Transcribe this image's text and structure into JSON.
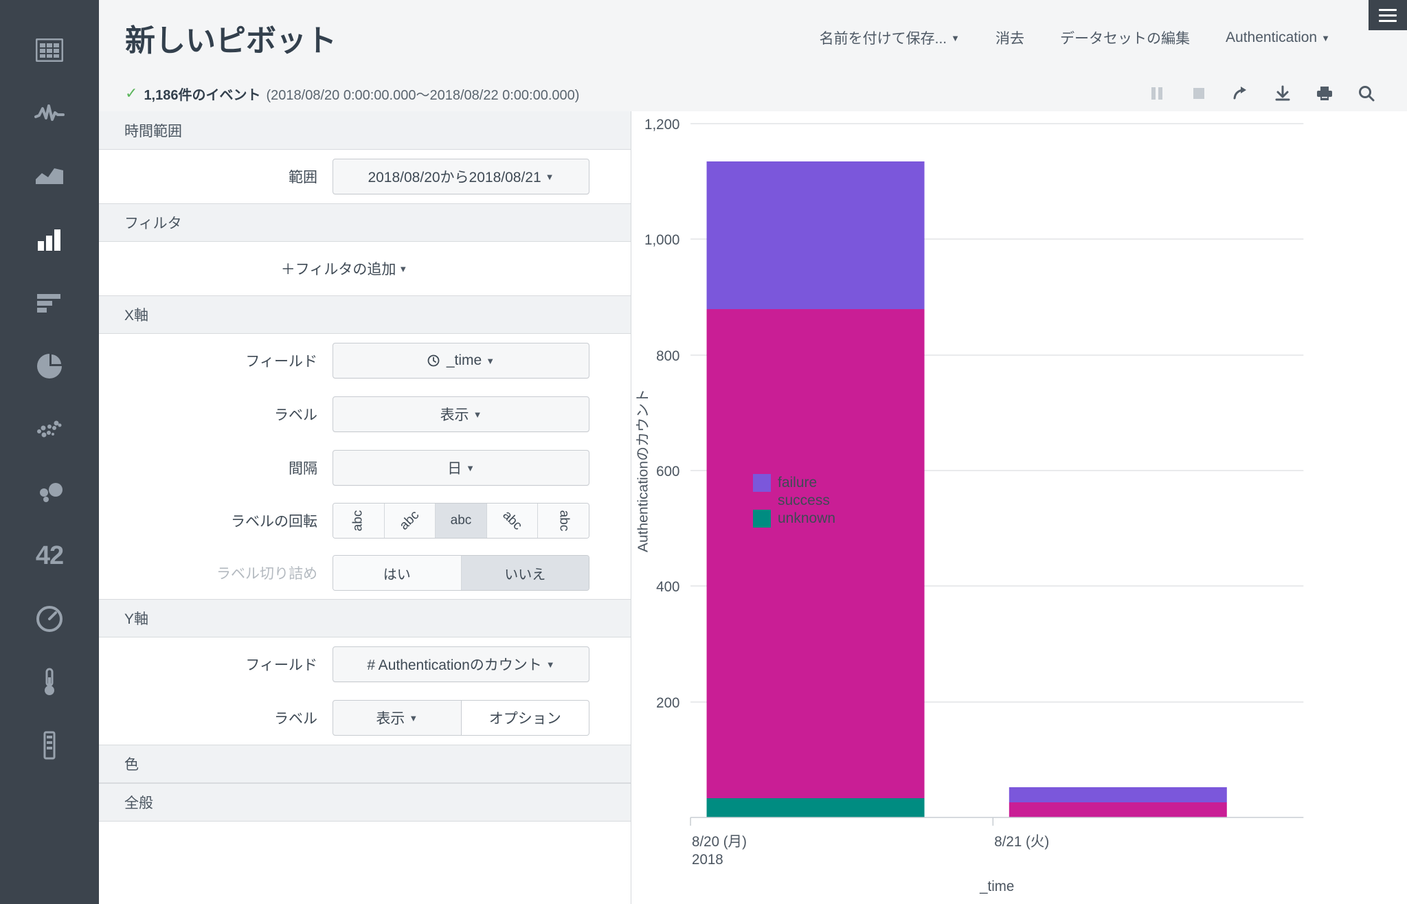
{
  "sidebar": {
    "items": [
      {
        "name": "table",
        "active": false
      },
      {
        "name": "line",
        "active": false
      },
      {
        "name": "area",
        "active": false
      },
      {
        "name": "column-bar",
        "active": true
      },
      {
        "name": "horizontal-bar",
        "active": false
      },
      {
        "name": "pie",
        "active": false
      },
      {
        "name": "scatter",
        "active": false
      },
      {
        "name": "bubble",
        "active": false
      },
      {
        "name": "single-value",
        "active": false,
        "text": "42"
      },
      {
        "name": "gauge-radial",
        "active": false
      },
      {
        "name": "gauge-thermometer",
        "active": false
      },
      {
        "name": "gauge-marker",
        "active": false
      }
    ]
  },
  "header": {
    "title": "新しいピボット",
    "nav": [
      {
        "label": "名前を付けて保存...",
        "caret": true
      },
      {
        "label": "消去",
        "caret": false
      },
      {
        "label": "データセットの編集",
        "caret": false
      },
      {
        "label": "Authentication",
        "caret": true
      }
    ],
    "menu_icon": "hamburger-icon"
  },
  "status": {
    "check": "✓",
    "count": "1,186件のイベント",
    "range": "(2018/08/20 0:00:00.000〜2018/08/22 0:00:00.000)",
    "tools": [
      {
        "name": "pause-icon",
        "disabled": true
      },
      {
        "name": "stop-icon",
        "disabled": true
      },
      {
        "name": "share-icon",
        "disabled": false
      },
      {
        "name": "download-icon",
        "disabled": false
      },
      {
        "name": "print-icon",
        "disabled": false
      },
      {
        "name": "search-icon",
        "disabled": false
      }
    ]
  },
  "panel": {
    "time_range": {
      "section": "時間範囲",
      "range_label": "範囲",
      "range_value": "2018/08/20から2018/08/21"
    },
    "filter": {
      "section": "フィルタ",
      "add_label": "＋フィルタの追加"
    },
    "x_axis": {
      "section": "X軸",
      "field_label": "フィールド",
      "field_value": "_time",
      "label_label": "ラベル",
      "label_value": "表示",
      "interval_label": "間隔",
      "interval_value": "日",
      "rotation_label": "ラベルの回転",
      "rotation_options": [
        "abc",
        "abc",
        "abc",
        "abc",
        "abc"
      ],
      "rotation_selected_index": 2,
      "truncate_label": "ラベル切り詰め",
      "truncate_options": [
        "はい",
        "いいえ"
      ],
      "truncate_selected_index": 1
    },
    "y_axis": {
      "section": "Y軸",
      "field_label": "フィールド",
      "field_value": "# Authenticationのカウント",
      "label_label": "ラベル",
      "label_value": "表示",
      "options_label": "オプション"
    },
    "color": {
      "section": "色"
    },
    "general": {
      "section": "全般"
    }
  },
  "chart_data": {
    "type": "bar",
    "stacked": true,
    "title": "",
    "xlabel": "_time",
    "ylabel": "Authenticationのカウント",
    "categories": [
      "8/20 (月)\n2018",
      "8/21 (火)"
    ],
    "category_lines": [
      [
        "8/20 (月)",
        "2018"
      ],
      [
        "8/21 (火)"
      ]
    ],
    "ylim": [
      0,
      1200
    ],
    "yticks": [
      0,
      200,
      400,
      600,
      800,
      1000,
      1200
    ],
    "ytick_labels": [
      "",
      "200",
      "400",
      "600",
      "800",
      "1,000",
      "1,200"
    ],
    "grid": true,
    "legend_position": "right",
    "series": [
      {
        "name": "unknown",
        "color": "#008C81",
        "values": [
          34,
          0
        ]
      },
      {
        "name": "success",
        "color": "#C91E95",
        "values": [
          845,
          27
        ]
      },
      {
        "name": "failure",
        "color": "#7B57DB",
        "values": [
          255,
          26
        ]
      }
    ],
    "totals": [
      1134,
      53
    ]
  }
}
